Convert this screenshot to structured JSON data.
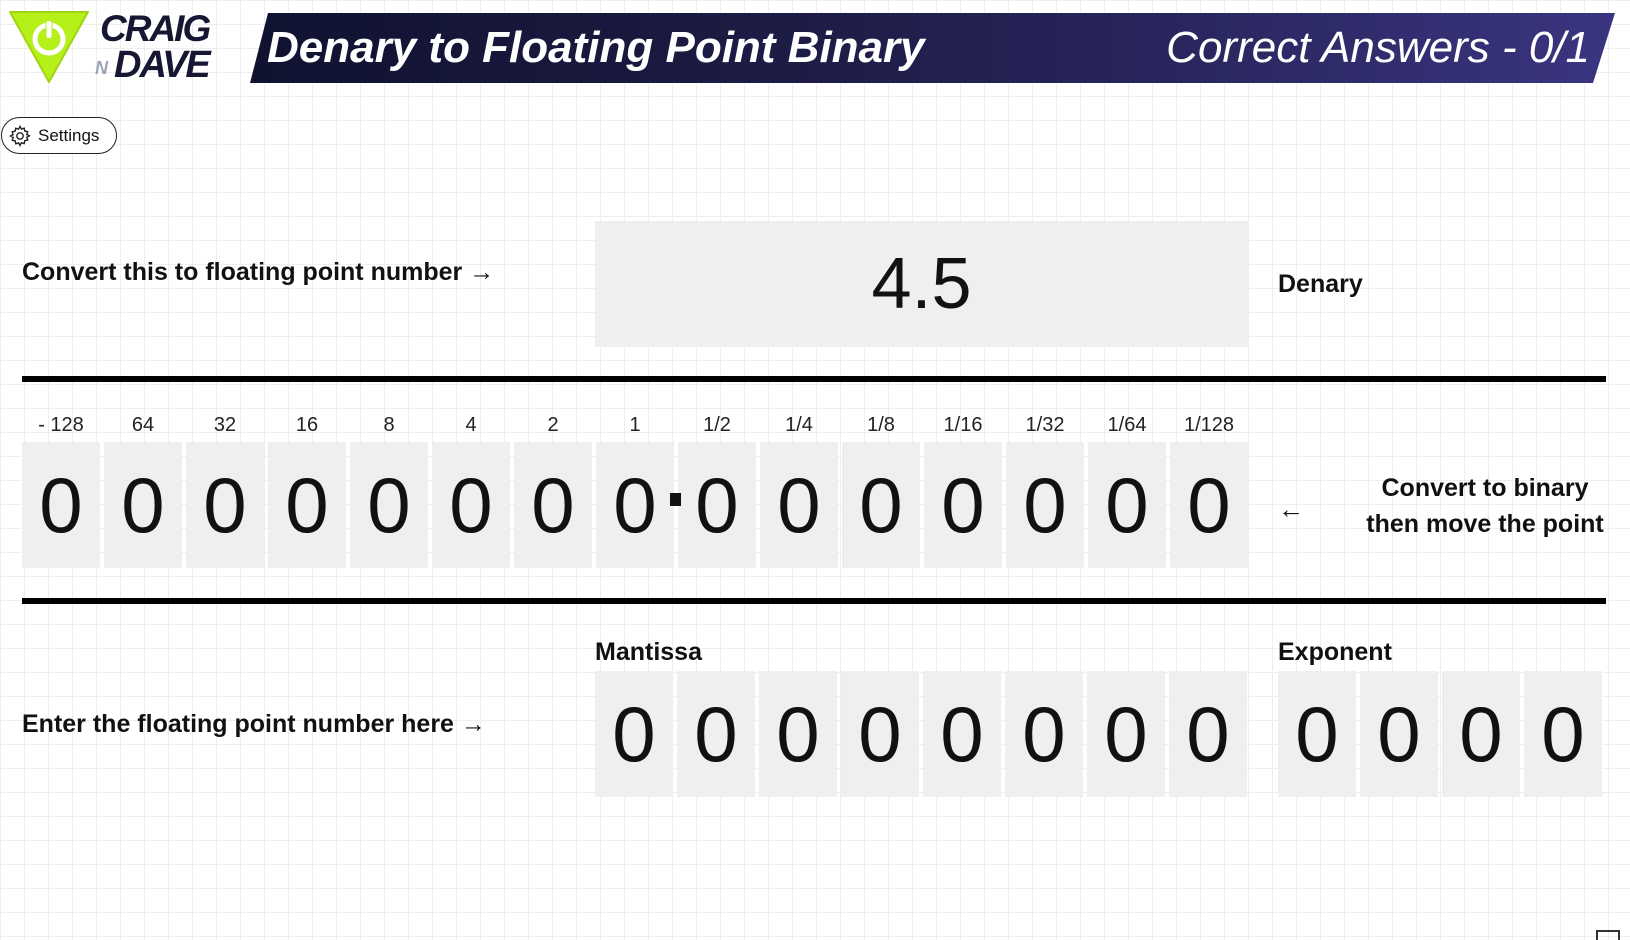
{
  "logo": {
    "line1": "CRAIG",
    "small": "N",
    "line2": "DAVE"
  },
  "header": {
    "title": "Denary to Floating Point Binary",
    "score": "Correct Answers - 0/1"
  },
  "settings": {
    "label": "Settings",
    "icon": "gear-icon"
  },
  "question": {
    "prompt": "Convert this to floating point number →",
    "value": "4.5",
    "unit": "Denary"
  },
  "conversion": {
    "place_values": [
      "- 128",
      "64",
      "32",
      "16",
      "8",
      "4",
      "2",
      "1",
      "1/2",
      "1/4",
      "1/8",
      "1/16",
      "1/32",
      "1/64",
      "1/128"
    ],
    "digits": [
      "0",
      "0",
      "0",
      "0",
      "0",
      "0",
      "0",
      "0",
      "0",
      "0",
      "0",
      "0",
      "0",
      "0",
      "0"
    ],
    "arrow": "←",
    "instruction_line1": "Convert to binary",
    "instruction_line2": "then move the point"
  },
  "answer": {
    "prompt": "Enter the floating point number here →",
    "mantissa_label": "Mantissa",
    "exponent_label": "Exponent",
    "mantissa": [
      "0",
      "0",
      "0",
      "0",
      "0",
      "0",
      "0",
      "0"
    ],
    "exponent": [
      "0",
      "0",
      "0",
      "0"
    ]
  },
  "colors": {
    "banner_dark": "#101230",
    "banner_light": "#3a3580",
    "logo_green": "#b6f01a",
    "box_grey": "#efefef"
  }
}
